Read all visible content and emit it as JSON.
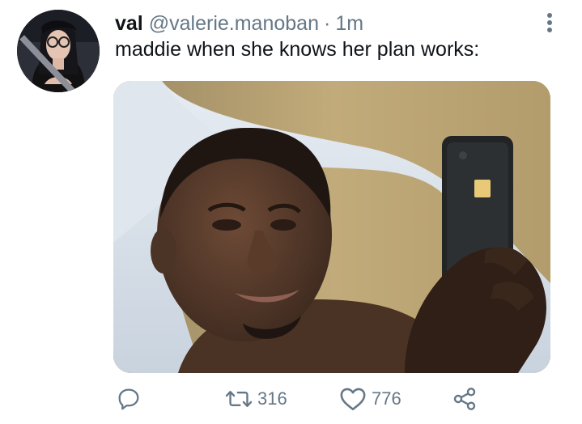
{
  "tweet": {
    "display_name": "val",
    "handle": "@valerie.manoban",
    "separator": "·",
    "timestamp": "1m",
    "text": "maddie when she knows her plan works:"
  },
  "actions": {
    "reply_icon": "reply-icon",
    "retweet_icon": "retweet-icon",
    "retweet_count": "316",
    "like_icon": "heart-icon",
    "like_count": "776",
    "share_icon": "share-icon"
  },
  "colors": {
    "text_primary": "#0f1419",
    "text_secondary": "#657786",
    "background": "#ffffff"
  }
}
